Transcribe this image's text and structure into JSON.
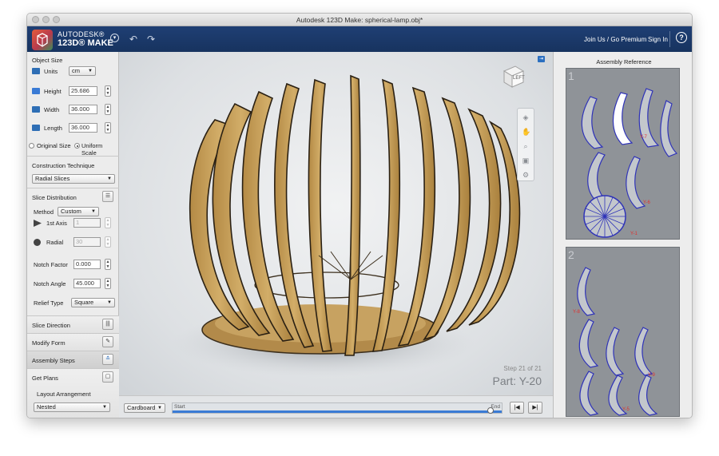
{
  "window": {
    "title": "Autodesk 123D Make: spherical-lamp.obj*"
  },
  "app": {
    "brand_line1": "AUTODESK®",
    "brand_line2": "123D® MAKE",
    "join_link": "Join Us / Go Premium",
    "sign_in": "Sign In",
    "help": "?"
  },
  "object_size": {
    "heading": "Object Size",
    "units_label": "Units",
    "units_value": "cm",
    "height_label": "Height",
    "height_value": "25.686",
    "width_label": "Width",
    "width_value": "36.000",
    "length_label": "Length",
    "length_value": "36.000",
    "original_size": "Original Size",
    "uniform_scale": "Uniform Scale"
  },
  "construction": {
    "heading": "Construction Technique",
    "value": "Radial Slices"
  },
  "slice_distribution": {
    "heading": "Slice Distribution",
    "method_label": "Method",
    "method_value": "Custom",
    "first_axis_label": "1st Axis",
    "first_axis_value": "1",
    "radial_label": "Radial",
    "radial_value": "30",
    "notch_factor_label": "Notch Factor",
    "notch_factor_value": "0.000",
    "notch_angle_label": "Notch Angle",
    "notch_angle_value": "45.000",
    "relief_type_label": "Relief Type",
    "relief_type_value": "Square"
  },
  "sections": {
    "slice_direction": "Slice Direction",
    "modify_form": "Modify Form",
    "assembly_steps": "Assembly Steps",
    "get_plans": "Get Plans",
    "layout_arrangement": "Layout Arrangement",
    "layout_value": "Nested"
  },
  "viewport": {
    "viewcube_label": "LEFT",
    "step_text": "Step 21 of 21",
    "part_text": "Part: Y-20"
  },
  "bottom": {
    "material": "Cardboard",
    "start_label": "Start",
    "end_label": "End",
    "progress": 1.0
  },
  "assembly_reference": {
    "title": "Assembly Reference",
    "sheets": [
      {
        "number": "1",
        "labels": [
          "Y-7",
          "Y-6",
          "Y-1"
        ]
      },
      {
        "number": "2",
        "labels": [
          "Y-8",
          "Y-9",
          "Y-5"
        ]
      }
    ]
  },
  "colors": {
    "appbar": "#1a3766",
    "accent": "#3a7bd5",
    "cardboard": "#c9a35f",
    "sheet_bg": "#8f9398",
    "part_outline": "#2f33b8"
  }
}
